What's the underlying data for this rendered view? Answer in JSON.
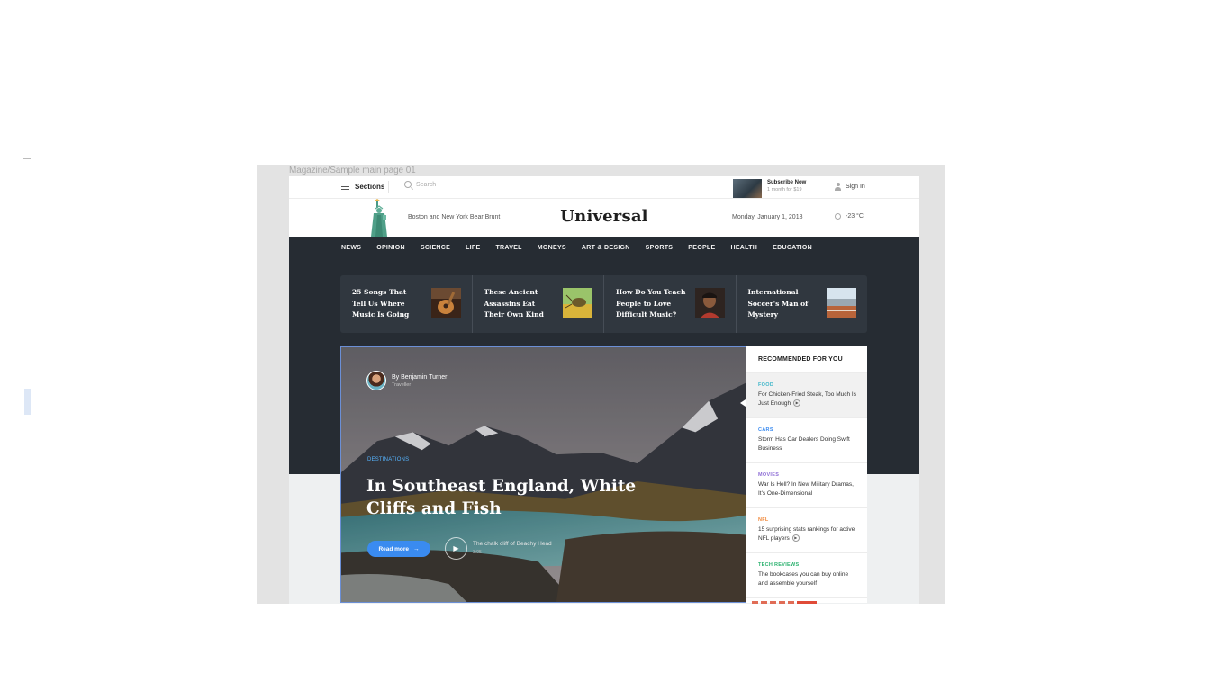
{
  "frame": {
    "label": "Magazine/Sample main page 01"
  },
  "topbar": {
    "sections_label": "Sections",
    "search_placeholder": "Search",
    "subscribe_title": "Subscribe Now",
    "subscribe_sub": "1 month for $19",
    "signin_label": "Sign In"
  },
  "masthead": {
    "headline_text": "Boston and New York Bear Brunt",
    "logo": "Universal",
    "date": "Monday, January 1, 2018",
    "weather": "-23 °C"
  },
  "nav": {
    "items": [
      "NEWS",
      "OPINION",
      "SCIENCE",
      "LIFE",
      "TRAVEL",
      "MONEYS",
      "ART & DESIGN",
      "SPORTS",
      "PEOPLE",
      "HEALTH",
      "EDUCATION"
    ]
  },
  "trending": [
    {
      "title": "25 Songs That Tell Us Where Music Is Going",
      "thumb": "guitar"
    },
    {
      "title": "These Ancient Assassins Eat Their Own Kind",
      "thumb": "insect"
    },
    {
      "title": "How Do You Teach People to Love Difficult Music?",
      "thumb": "portrait"
    },
    {
      "title": "International Soccer's Man of Mystery",
      "thumb": "stadium"
    }
  ],
  "hero": {
    "author_name": "By Benjamin Turner",
    "author_role": "Traveller",
    "category": "DESTINATIONS",
    "title": "In Southeast England, White Cliffs and Fish",
    "read_more": "Read more",
    "caption": "The chalk cliff of Beachy Head",
    "caption_sub": "3:05"
  },
  "recommended": {
    "header": "RECOMMENDED FOR YOU",
    "items": [
      {
        "category": "FOOD",
        "title": "For Chicken-Fried Steak, Too Much Is Just Enough",
        "color": "#3fb6c9",
        "arrow": true
      },
      {
        "category": "CARS",
        "title": "Storm Has Car Dealers Doing Swift Business",
        "color": "#3a8bf0",
        "arrow": false
      },
      {
        "category": "MOVIES",
        "title": "War Is Hell? In New Military Dramas, It's One-Dimensional",
        "color": "#8f6fd6",
        "arrow": false
      },
      {
        "category": "NFL",
        "title": "15 surprising stats rankings for active NFL players",
        "color": "#f0883a",
        "arrow": true
      },
      {
        "category": "TECH REVIEWS",
        "title": "The bookcases you can buy online and assemble yourself",
        "color": "#2fb371",
        "arrow": false
      }
    ]
  },
  "colors": {
    "accent": "#3a8bf0",
    "dark_band": "#262c33",
    "strip": "#30373f"
  }
}
